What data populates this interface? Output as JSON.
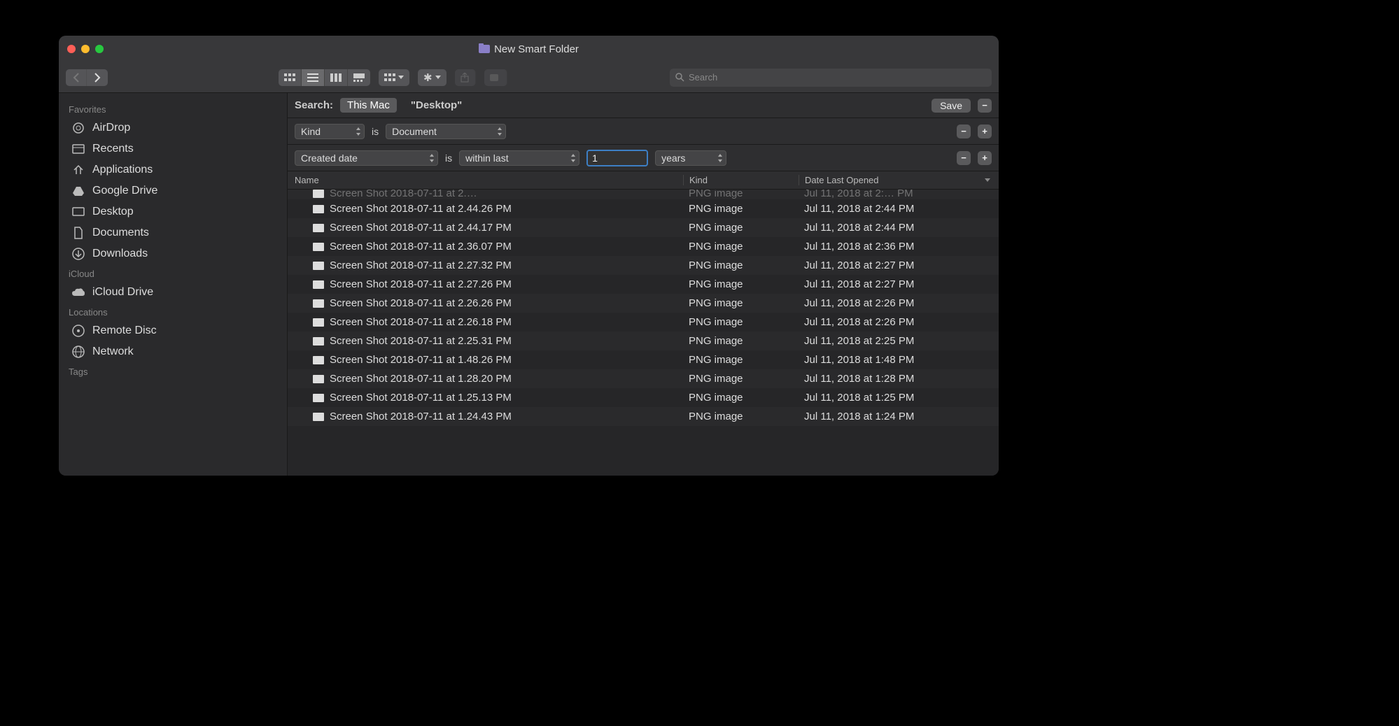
{
  "window": {
    "title": "New Smart Folder"
  },
  "toolbar": {
    "search_placeholder": "Search"
  },
  "sidebar": {
    "sections": [
      {
        "label": "Favorites",
        "items": [
          {
            "icon": "airdrop",
            "label": "AirDrop"
          },
          {
            "icon": "recents",
            "label": "Recents"
          },
          {
            "icon": "apps",
            "label": "Applications"
          },
          {
            "icon": "gdrive",
            "label": "Google Drive"
          },
          {
            "icon": "desktop",
            "label": "Desktop"
          },
          {
            "icon": "documents",
            "label": "Documents"
          },
          {
            "icon": "downloads",
            "label": "Downloads"
          }
        ]
      },
      {
        "label": "iCloud",
        "items": [
          {
            "icon": "cloud",
            "label": "iCloud Drive"
          }
        ]
      },
      {
        "label": "Locations",
        "items": [
          {
            "icon": "disc",
            "label": "Remote Disc"
          },
          {
            "icon": "network",
            "label": "Network"
          }
        ]
      },
      {
        "label": "Tags",
        "items": []
      }
    ]
  },
  "search": {
    "label": "Search:",
    "scopes": {
      "active": "This Mac",
      "other": "\"Desktop\""
    },
    "save_label": "Save"
  },
  "criteria": [
    {
      "attr": "Kind",
      "op": "is",
      "value_dd": "Document"
    },
    {
      "attr": "Created date",
      "op": "is",
      "value_dd": "within last",
      "num": "1",
      "unit": "years"
    }
  ],
  "columns": {
    "name": "Name",
    "kind": "Kind",
    "date": "Date Last Opened"
  },
  "rows": [
    {
      "name": "Screen Shot 2018-07-11 at 2.44.26 PM",
      "kind": "PNG image",
      "date": "Jul 11, 2018 at 2:44 PM"
    },
    {
      "name": "Screen Shot 2018-07-11 at 2.44.17 PM",
      "kind": "PNG image",
      "date": "Jul 11, 2018 at 2:44 PM"
    },
    {
      "name": "Screen Shot 2018-07-11 at 2.36.07 PM",
      "kind": "PNG image",
      "date": "Jul 11, 2018 at 2:36 PM"
    },
    {
      "name": "Screen Shot 2018-07-11 at 2.27.32 PM",
      "kind": "PNG image",
      "date": "Jul 11, 2018 at 2:27 PM"
    },
    {
      "name": "Screen Shot 2018-07-11 at 2.27.26 PM",
      "kind": "PNG image",
      "date": "Jul 11, 2018 at 2:27 PM"
    },
    {
      "name": "Screen Shot 2018-07-11 at 2.26.26 PM",
      "kind": "PNG image",
      "date": "Jul 11, 2018 at 2:26 PM"
    },
    {
      "name": "Screen Shot 2018-07-11 at 2.26.18 PM",
      "kind": "PNG image",
      "date": "Jul 11, 2018 at 2:26 PM"
    },
    {
      "name": "Screen Shot 2018-07-11 at 2.25.31 PM",
      "kind": "PNG image",
      "date": "Jul 11, 2018 at 2:25 PM"
    },
    {
      "name": "Screen Shot 2018-07-11 at 1.48.26 PM",
      "kind": "PNG image",
      "date": "Jul 11, 2018 at 1:48 PM"
    },
    {
      "name": "Screen Shot 2018-07-11 at 1.28.20 PM",
      "kind": "PNG image",
      "date": "Jul 11, 2018 at 1:28 PM"
    },
    {
      "name": "Screen Shot 2018-07-11 at 1.25.13 PM",
      "kind": "PNG image",
      "date": "Jul 11, 2018 at 1:25 PM"
    },
    {
      "name": "Screen Shot 2018-07-11 at 1.24.43 PM",
      "kind": "PNG image",
      "date": "Jul 11, 2018 at 1:24 PM"
    }
  ]
}
